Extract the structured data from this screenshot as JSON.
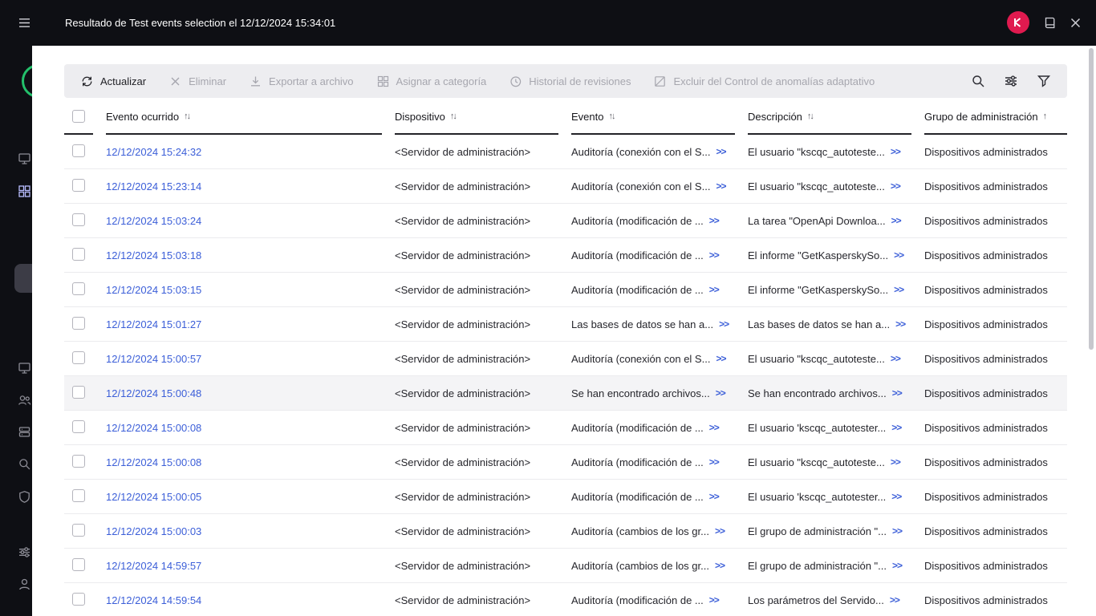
{
  "window": {
    "title": "Resultado de Test events selection el 12/12/2024 15:34:01"
  },
  "topbar": {
    "icons": [
      "kaspersky-logo-badge",
      "help-book-icon",
      "close-icon"
    ]
  },
  "sidebar": {
    "icons": [
      "menu-icon",
      "monitoring-icon",
      "dashboard-grid-icon",
      "devices-monitor-icon",
      "users-icon",
      "servers-icon",
      "search-icon",
      "shield-icon",
      "settings-sliders-icon",
      "user-account-icon"
    ]
  },
  "toolbar": {
    "buttons": [
      {
        "label": "Actualizar",
        "enabled": true,
        "icon": "refresh-icon"
      },
      {
        "label": "Eliminar",
        "enabled": false,
        "icon": "delete-x-icon"
      },
      {
        "label": "Exportar a archivo",
        "enabled": false,
        "icon": "export-download-icon"
      },
      {
        "label": "Asignar a categoría",
        "enabled": false,
        "icon": "assign-category-icon"
      },
      {
        "label": "Historial de revisiones",
        "enabled": false,
        "icon": "revision-history-icon"
      },
      {
        "label": "Excluir del Control de anomalías adaptativo",
        "enabled": false,
        "icon": "exclude-icon"
      }
    ],
    "right_icons": [
      "search-icon",
      "column-settings-icon",
      "filter-funnel-icon"
    ]
  },
  "table": {
    "expand_glyph": ">>",
    "columns": [
      {
        "label": "Evento ocurrido",
        "sort": "↑↓"
      },
      {
        "label": "Dispositivo",
        "sort": "↑↓"
      },
      {
        "label": "Evento",
        "sort": "↑↓"
      },
      {
        "label": "Descripción",
        "sort": "↑↓"
      },
      {
        "label": "Grupo de administración",
        "sort": "↑"
      }
    ],
    "rows": [
      {
        "time": "12/12/2024 15:24:32",
        "device": "<Servidor de administración>",
        "event": "Auditoría (conexión con el S...",
        "description": "El usuario \"kscqc_autoteste...",
        "group": "Dispositivos administrados",
        "highlighted": false
      },
      {
        "time": "12/12/2024 15:23:14",
        "device": "<Servidor de administración>",
        "event": "Auditoría (conexión con el S...",
        "description": "El usuario \"kscqc_autoteste...",
        "group": "Dispositivos administrados",
        "highlighted": false
      },
      {
        "time": "12/12/2024 15:03:24",
        "device": "<Servidor de administración>",
        "event": "Auditoría (modificación de ...",
        "description": "La tarea \"OpenApi Downloa...",
        "group": "Dispositivos administrados",
        "highlighted": false
      },
      {
        "time": "12/12/2024 15:03:18",
        "device": "<Servidor de administración>",
        "event": "Auditoría (modificación de ...",
        "description": "El informe \"GetKasperskySo...",
        "group": "Dispositivos administrados",
        "highlighted": false
      },
      {
        "time": "12/12/2024 15:03:15",
        "device": "<Servidor de administración>",
        "event": "Auditoría (modificación de ...",
        "description": "El informe \"GetKasperskySo...",
        "group": "Dispositivos administrados",
        "highlighted": false
      },
      {
        "time": "12/12/2024 15:01:27",
        "device": "<Servidor de administración>",
        "event": "Las bases de datos se han a...",
        "description": "Las bases de datos se han a...",
        "group": "Dispositivos administrados",
        "highlighted": false
      },
      {
        "time": "12/12/2024 15:00:57",
        "device": "<Servidor de administración>",
        "event": "Auditoría (conexión con el S...",
        "description": "El usuario \"kscqc_autoteste...",
        "group": "Dispositivos administrados",
        "highlighted": false
      },
      {
        "time": "12/12/2024 15:00:48",
        "device": "<Servidor de administración>",
        "event": "Se han encontrado archivos...",
        "description": "Se han encontrado archivos...",
        "group": "Dispositivos administrados",
        "highlighted": true
      },
      {
        "time": "12/12/2024 15:00:08",
        "device": "<Servidor de administración>",
        "event": "Auditoría (modificación de ...",
        "description": "El usuario 'kscqc_autotester...",
        "group": "Dispositivos administrados",
        "highlighted": false
      },
      {
        "time": "12/12/2024 15:00:08",
        "device": "<Servidor de administración>",
        "event": "Auditoría (modificación de ...",
        "description": "El usuario \"kscqc_autoteste...",
        "group": "Dispositivos administrados",
        "highlighted": false
      },
      {
        "time": "12/12/2024 15:00:05",
        "device": "<Servidor de administración>",
        "event": "Auditoría (modificación de ...",
        "description": "El usuario 'kscqc_autotester...",
        "group": "Dispositivos administrados",
        "highlighted": false
      },
      {
        "time": "12/12/2024 15:00:03",
        "device": "<Servidor de administración>",
        "event": "Auditoría (cambios de los gr...",
        "description": "El grupo de administración \"...",
        "group": "Dispositivos administrados",
        "highlighted": false
      },
      {
        "time": "12/12/2024 14:59:57",
        "device": "<Servidor de administración>",
        "event": "Auditoría (cambios de los gr...",
        "description": "El grupo de administración \"...",
        "group": "Dispositivos administrados",
        "highlighted": false
      },
      {
        "time": "12/12/2024 14:59:54",
        "device": "<Servidor de administración>",
        "event": "Auditoría (modificación de ...",
        "description": "Los parámetros del Servido...",
        "group": "Dispositivos administrados",
        "highlighted": false
      }
    ]
  },
  "colors": {
    "link_blue": "#3b5ed8",
    "topbar_bg": "#0e0f14",
    "kaspersky_red": "#e01a4f",
    "logo_green": "#23c06b",
    "toolbar_bg": "#ededf0",
    "row_border": "#ebebee",
    "row_highlight": "#f4f4f6"
  }
}
